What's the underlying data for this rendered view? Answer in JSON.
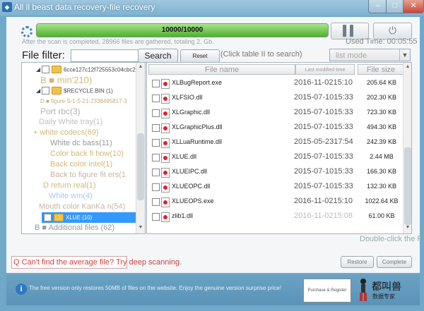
{
  "window": {
    "title": "All ll beast data recovery-file recovery"
  },
  "scan": {
    "progress_text": "10000/10000",
    "progress_fraction": 1.0,
    "status": "After the scan is completed, 28966 files are gathered, totaling 2. Gb.",
    "used_time": "Used Time: 00:05:55"
  },
  "controls": {
    "pause_icon": "pause-icon",
    "stop_icon": "stop-icon"
  },
  "filter": {
    "label": "File filter:",
    "value": "",
    "search_label": "Search",
    "reset_label": "Reset",
    "hint": "(Click table II to search)",
    "mode": "list mode"
  },
  "tree": {
    "nodes": [
      {
        "text": "6cce127c12f725553c04cbc2"
      },
      {
        "text": "B ■ min'210)"
      },
      {
        "text": "$RECYCLE.BIN (1)"
      },
      {
        "text": "D ■ figure S-1-5-21-2338495817-3"
      },
      {
        "text": "Port rbc(3)"
      },
      {
        "text": "Daily White tray(1)"
      },
      {
        "text": "+ white codecs(69)"
      },
      {
        "text": "White dc bass(11)"
      },
      {
        "text": "Color back fi   how(10)"
      },
      {
        "text": "Back color intel(1)"
      },
      {
        "text": "Back to figure   fit ers(1"
      },
      {
        "text": "D return real(1)"
      },
      {
        "text": "White wm(4)"
      },
      {
        "text": "Mouth color KanKa n(54)"
      },
      {
        "text": "XLUE (10)"
      },
      {
        "text": "B ■ Additional files (62)"
      }
    ]
  },
  "files": {
    "headers": {
      "name": "File name",
      "modified": "Last modified time",
      "size": "File size"
    },
    "rows": [
      {
        "name": "XLBugReport.exe",
        "modified": "2016-11-0215:10",
        "size": "205.64 KB"
      },
      {
        "name": "XLFSIO.dll",
        "modified": "2015-07-1015:33",
        "size": "202.30 KB"
      },
      {
        "name": "XLGraphic.dll",
        "modified": "2015-07-1015:33",
        "size": "723.30 KB"
      },
      {
        "name": "XLGraphicPlus.dll",
        "modified": "2015-07-1015:33",
        "size": "494.30 KB"
      },
      {
        "name": "XLLuaRuntime.dll",
        "modified": "2015-05-2317:54",
        "size": "242.39 KB"
      },
      {
        "name": "XLUE.dll",
        "modified": "2015-07-1015:33",
        "size": "2.44 MB"
      },
      {
        "name": "XLUEIPC.dll",
        "modified": "2015-07-1015:33",
        "size": "166.30 KB"
      },
      {
        "name": "XLUEOPC.dll",
        "modified": "2015-07-1015:33",
        "size": "132.30 KB"
      },
      {
        "name": "XLUEOPS.exe",
        "modified": "2016-11-0215:10",
        "size": "1022.64 KB"
      },
      {
        "name": "zlib1.dll",
        "modified": "2016-11-0215:08",
        "size": "61.00 KB"
      }
    ]
  },
  "hints": {
    "double_click": "Double-click the F"
  },
  "footer": {
    "deep_scan": "Q Can't find the average file? Try deep scanning.",
    "restore_label": "Restore",
    "complete_label": "Complete",
    "info": "The free version only restores 50MB of files on the website. Enjoy the genuine version surprise price!",
    "purchase_label": "Purchase & Register",
    "brand_name": "都叫兽",
    "brand_sub": "数据专家"
  }
}
